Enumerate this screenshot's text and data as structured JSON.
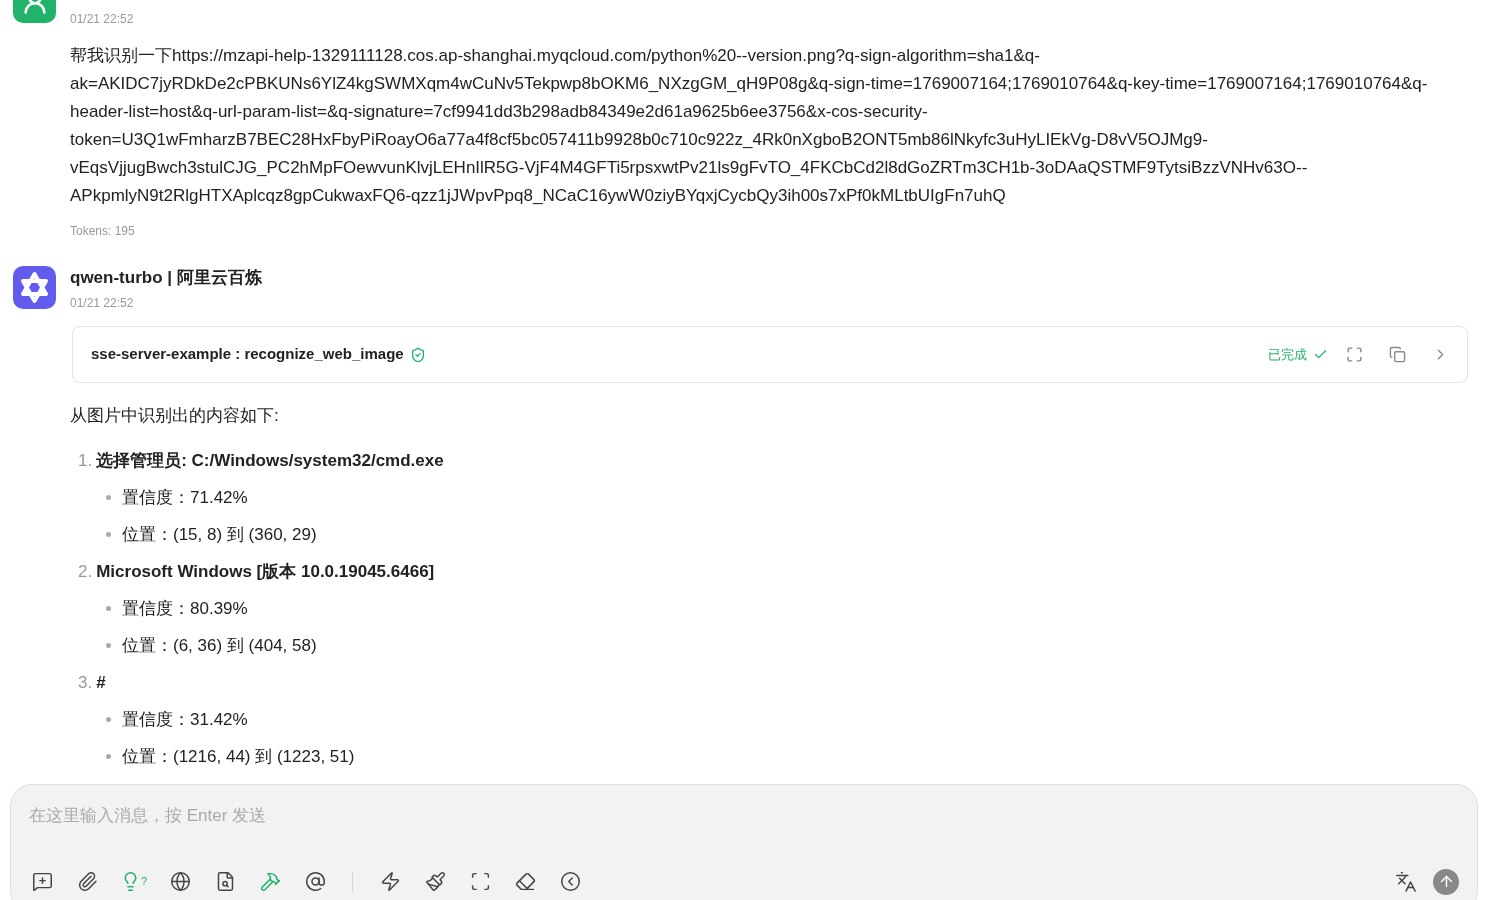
{
  "messages": [
    {
      "time": "01/21 22:52",
      "text": "帮我识别一下https://mzapi-help-1329111128.cos.ap-shanghai.myqcloud.com/python%20--version.png?q-sign-algorithm=sha1&q-ak=AKIDC7jyRDkDe2cPBKUNs6YlZ4kgSWMXqm4wCuNv5Tekpwp8bOKM6_NXzgGM_qH9P08g&q-sign-time=1769007164;1769010764&q-key-time=1769007164;1769010764&q-header-list=host&q-url-param-list=&q-signature=7cf9941dd3b298adb84349e2d61a9625b6ee3756&x-cos-security-token=U3Q1wFmharzB7BEC28HxFbyPiRoayO6a77a4f8cf5bc057411b9928b0c710c922z_4Rk0nXgboB2ONT5mb86lNkyfc3uHyLIEkVg-D8vV5OJMg9-vEqsVjjugBwch3stulCJG_PC2hMpFOewvunKlvjLEHnIlR5G-VjF4M4GFTi5rpsxwtPv21ls9gFvTO_4FKCbCd2l8dGoZRTm3CH1b-3oDAaQSTMF9TytsiBzzVNHv63O--APkpmlyN9t2RlgHTXAplcqz8gpCukwaxFQ6-qzz1jJWpvPpq8_NCaC16ywW0ziyBYqxjCycbQy3ih00s7xPf0kMLtbUIgFn7uhQ",
      "tokens": "Tokens: 195"
    },
    {
      "name": "qwen-turbo | 阿里云百炼",
      "time": "01/21 22:52",
      "tool_call": {
        "label": "sse-server-example : recognize_web_image",
        "status": "已完成",
        "done": true
      },
      "intro": "从图片中识别出的内容如下:",
      "items": [
        {
          "number": "1.",
          "title": "选择管理员: C:/Windows/system32/cmd.exe",
          "details": [
            "置信度：71.42%",
            "位置：(15, 8) 到 (360, 29)"
          ]
        },
        {
          "number": "2.",
          "title": "Microsoft Windows [版本 10.0.19045.6466]",
          "details": [
            "置信度：80.39%",
            "位置：(6, 36) 到 (404, 58)"
          ]
        },
        {
          "number": "3.",
          "title": "#",
          "details": [
            "置信度：31.42%",
            "位置：(1216, 44) 到 (1223, 51)"
          ]
        }
      ]
    }
  ],
  "composer": {
    "placeholder": "在这里输入消息，按 Enter 发送",
    "think_hint": "?",
    "tools": [
      {
        "kind": "new-topic",
        "active": false
      },
      {
        "kind": "attach",
        "active": false
      },
      {
        "kind": "think",
        "active": true
      },
      {
        "kind": "web",
        "active": false
      },
      {
        "kind": "knowledge",
        "active": false
      },
      {
        "kind": "mcp",
        "active": true
      },
      {
        "kind": "mention",
        "active": false
      },
      {
        "kind": "divider"
      },
      {
        "kind": "quick",
        "active": false
      },
      {
        "kind": "clear",
        "active": false
      },
      {
        "kind": "expand",
        "active": false
      },
      {
        "kind": "eraser",
        "active": false
      },
      {
        "kind": "collapse",
        "active": false
      }
    ]
  }
}
